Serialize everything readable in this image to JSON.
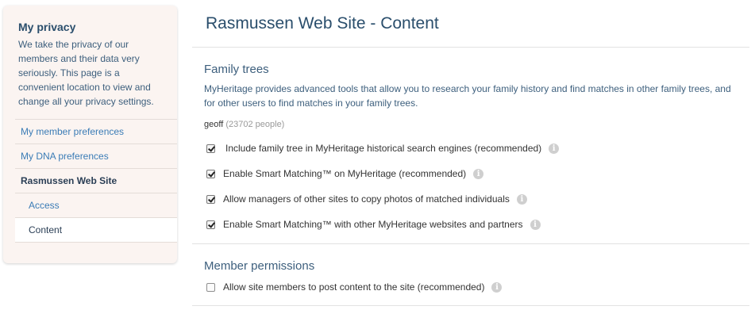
{
  "sidebar": {
    "title": "My privacy",
    "description": "We take the privacy of our members and their data very seriously. This page is a convenient location to view and change all your privacy settings.",
    "items": [
      {
        "label": "My member preferences"
      },
      {
        "label": "My DNA preferences"
      },
      {
        "label": "Rasmussen Web Site"
      },
      {
        "label": "Access"
      },
      {
        "label": "Content"
      }
    ]
  },
  "main": {
    "title": "Rasmussen Web Site - Content",
    "family_trees": {
      "title": "Family trees",
      "description": "MyHeritage provides advanced tools that allow you to research your family history and find matches in other family trees, and for other users to find matches in your family trees.",
      "tree_name": "geoff",
      "tree_count": "(23702 people)",
      "options": [
        {
          "label": "Include family tree in MyHeritage historical search engines (recommended)",
          "checked": true
        },
        {
          "label": "Enable Smart Matching™ on MyHeritage (recommended)",
          "checked": true
        },
        {
          "label": "Allow managers of other sites to copy photos of matched individuals",
          "checked": true
        },
        {
          "label": "Enable Smart Matching™ with other MyHeritage websites and partners",
          "checked": true
        }
      ]
    },
    "member_permissions": {
      "title": "Member permissions",
      "options": [
        {
          "label": "Allow site members to post content to the site (recommended)",
          "checked": false
        }
      ]
    }
  },
  "icons": {
    "info": "info-icon"
  }
}
